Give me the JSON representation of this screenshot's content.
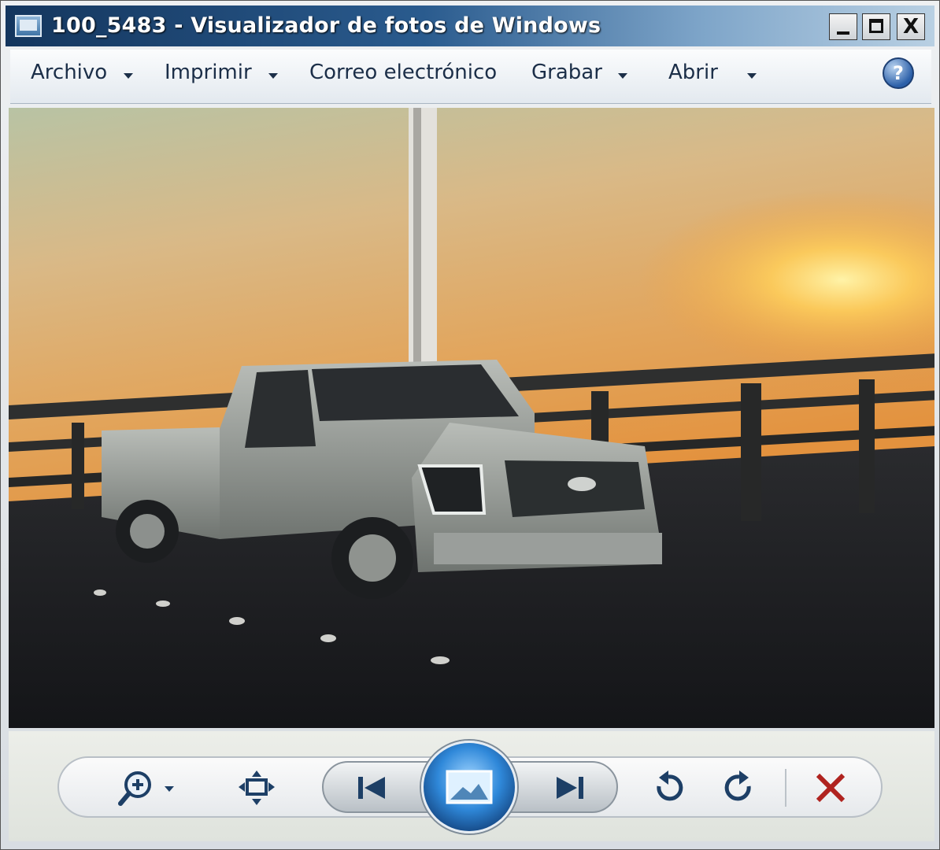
{
  "window": {
    "title": "100_5483 - Visualizador de fotos de Windows",
    "close_glyph": "X"
  },
  "menu": {
    "items": [
      {
        "label": "Archivo",
        "has_dropdown": true
      },
      {
        "label": "Imprimir",
        "has_dropdown": true
      },
      {
        "label": "Correo electrónico",
        "has_dropdown": false
      },
      {
        "label": "Grabar",
        "has_dropdown": true
      },
      {
        "label": "Abrir",
        "has_dropdown": true
      }
    ],
    "help_glyph": "?"
  },
  "photo": {
    "subject": "pickup-truck-on-bridge-at-sunset"
  },
  "controls": {
    "icons": [
      "zoom-icon",
      "actual-size-icon",
      "previous-icon",
      "slideshow-icon",
      "next-icon",
      "rotate-counterclockwise-icon",
      "rotate-clockwise-icon",
      "delete-icon"
    ]
  },
  "colors": {
    "title_bar": "#14365e",
    "delete_red": "#b0231f",
    "play_blue": "#2f88d9"
  }
}
